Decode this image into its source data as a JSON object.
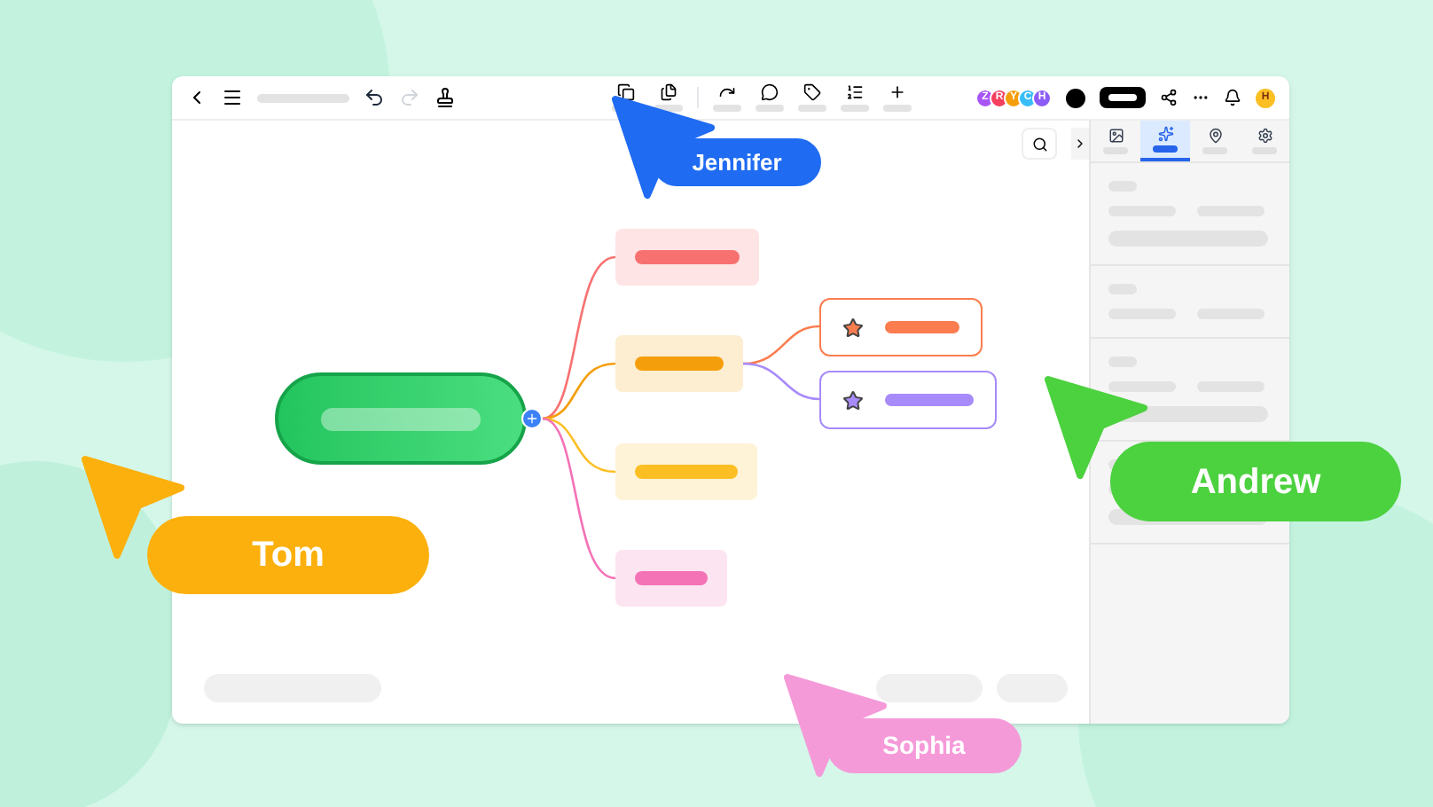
{
  "toolbar": {
    "tools": [
      {
        "kind": "undo",
        "disabled": false
      },
      {
        "kind": "redo",
        "disabled": true
      }
    ],
    "avatars": [
      {
        "initial": "Z",
        "color": "#a855f7"
      },
      {
        "initial": "R",
        "color": "#f43f5e"
      },
      {
        "initial": "Y",
        "color": "#f59e0b"
      },
      {
        "initial": "C",
        "color": "#38bdf8"
      },
      {
        "initial": "H",
        "color": "#8b5cf6"
      }
    ],
    "user_initial": "H"
  },
  "panel_tabs": [
    {
      "selected": false
    },
    {
      "selected": true
    },
    {
      "selected": false
    },
    {
      "selected": false
    }
  ],
  "mind_map": {
    "branches": [
      {
        "color": "#f87171"
      },
      {
        "color": "#f59e0b",
        "children": [
          {
            "color": "#fb7d4f"
          },
          {
            "color": "#a78bfa"
          }
        ]
      },
      {
        "color": "#fbbf24"
      },
      {
        "color": "#f472b6"
      }
    ]
  },
  "cursors": [
    {
      "name": "Jennifer",
      "color": "#1f6bf2"
    },
    {
      "name": "Tom",
      "color": "#fbb00d"
    },
    {
      "name": "Andrew",
      "color": "#4cd13f"
    },
    {
      "name": "Sophia",
      "color": "#f59ad8"
    }
  ]
}
